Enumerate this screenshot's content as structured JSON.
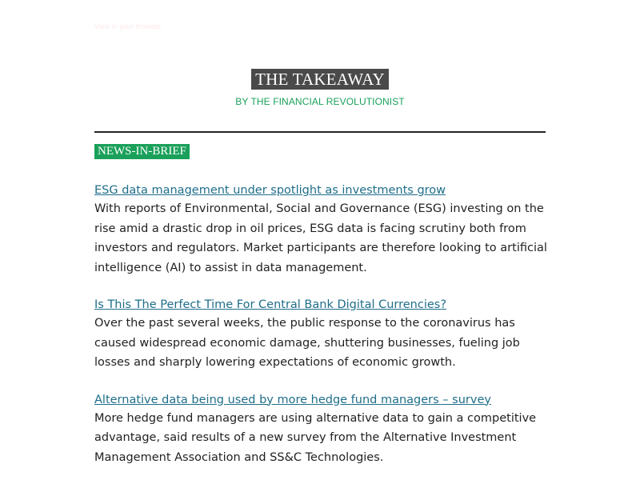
{
  "preheader": {
    "link_text": "View in your browser"
  },
  "masthead": {
    "title": "THE TAKEAWAY",
    "byline": "BY THE FINANCIAL REVOLUTIONIST"
  },
  "section": {
    "label": "NEWS-IN-BRIEF"
  },
  "articles": [
    {
      "title": "ESG data management under spotlight as investments grow",
      "body": "With reports of Environmental, Social and Governance (ESG) investing on the rise amid a drastic drop in oil prices, ESG data is facing scrutiny both from investors and regulators. Market participants are therefore looking to artificial intelligence (AI) to assist in data management."
    },
    {
      "title": "Is This The Perfect Time For Central Bank Digital Currencies?",
      "body": "Over the past several weeks, the public response to the coronavirus has caused widespread economic damage, shuttering businesses, fueling job losses and sharply lowering expectations of economic growth."
    },
    {
      "title": "Alternative data being used by more hedge fund managers – survey",
      "body": "More hedge fund managers are using alternative data to gain a competitive advantage, said results of a new survey from the Alternative Investment Management Association and SS&C Technologies."
    }
  ],
  "colors": {
    "accent_green": "#1aa05a",
    "title_box": "#4a4a4a",
    "link": "#1f6e8a",
    "body_text": "#222222"
  }
}
